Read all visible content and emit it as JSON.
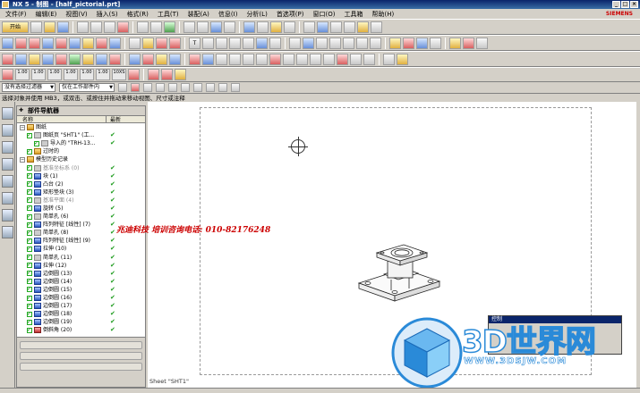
{
  "window": {
    "title": "NX 5 - 制图 - [half_pictorial.prt]",
    "brand": "SIEMENS",
    "buttons": [
      "_",
      "□",
      "×"
    ]
  },
  "menu": {
    "items": [
      "文件(F)",
      "编辑(E)",
      "视图(V)",
      "插入(S)",
      "格式(R)",
      "工具(T)",
      "装配(A)",
      "信息(I)",
      "分析(L)",
      "首选项(P)",
      "窗口(O)",
      "工具箱",
      "帮助(H)"
    ]
  },
  "toolbar_rows": [
    {
      "start_label": "开始"
    },
    {
      "labels": [
        "T"
      ]
    },
    {
      "labels": [
        "1.00",
        "1.00",
        "1.00",
        "1.00",
        "1.00",
        "1.00",
        "10XS"
      ]
    }
  ],
  "filter": {
    "selection_filter": "没有选择过滤器",
    "scope": "仅在工作部件内"
  },
  "status": {
    "prompt": "选择对象并使用 MB3，或双击、或按住并拖动来移动视图、尺寸或注释"
  },
  "navigator": {
    "title": "部件导航器",
    "columns": [
      "名称",
      "最新"
    ],
    "items": [
      {
        "label": "图纸",
        "indent": 0,
        "icon": "folder",
        "ok": false
      },
      {
        "label": "图纸页 \"SHT1\" (工...",
        "indent": 1,
        "icon": "sheet",
        "ok": true
      },
      {
        "label": "导入的 \"TRH-13...",
        "indent": 2,
        "icon": "import",
        "ok": true
      },
      {
        "label": "过时的",
        "indent": 1,
        "icon": "folder",
        "ok": false
      },
      {
        "label": "模型历史记录",
        "indent": 0,
        "icon": "folder",
        "ok": false
      },
      {
        "label": "基准坐标系 (0)",
        "indent": 1,
        "icon": "datum",
        "ok": true,
        "muted": true
      },
      {
        "label": "块 (1)",
        "indent": 1,
        "icon": "block",
        "ok": true
      },
      {
        "label": "凸台 (2)",
        "indent": 1,
        "icon": "block",
        "ok": true
      },
      {
        "label": "矩形垫块 (3)",
        "indent": 1,
        "icon": "block",
        "ok": true
      },
      {
        "label": "基准平面 (4)",
        "indent": 1,
        "icon": "datum",
        "ok": true,
        "muted": true
      },
      {
        "label": "旋转 (5)",
        "indent": 1,
        "icon": "block",
        "ok": true
      },
      {
        "label": "简单孔 (6)",
        "indent": 1,
        "icon": "hole",
        "ok": true
      },
      {
        "label": "阵列特征 [线性] (7)",
        "indent": 1,
        "icon": "pattern",
        "ok": true
      },
      {
        "label": "简单孔 (8)",
        "indent": 1,
        "icon": "hole",
        "ok": true
      },
      {
        "label": "阵列特征 [线性] (9)",
        "indent": 1,
        "icon": "pattern",
        "ok": true
      },
      {
        "label": "拉伸 (10)",
        "indent": 1,
        "icon": "block",
        "ok": true
      },
      {
        "label": "简单孔 (11)",
        "indent": 1,
        "icon": "hole",
        "ok": true
      },
      {
        "label": "拉伸 (12)",
        "indent": 1,
        "icon": "block",
        "ok": true
      },
      {
        "label": "边倒圆 (13)",
        "indent": 1,
        "icon": "blend",
        "ok": true
      },
      {
        "label": "边倒圆 (14)",
        "indent": 1,
        "icon": "blend",
        "ok": true
      },
      {
        "label": "边倒圆 (15)",
        "indent": 1,
        "icon": "blend",
        "ok": true
      },
      {
        "label": "边倒圆 (16)",
        "indent": 1,
        "icon": "blend",
        "ok": true
      },
      {
        "label": "边倒圆 (17)",
        "indent": 1,
        "icon": "blend",
        "ok": true
      },
      {
        "label": "边倒圆 (18)",
        "indent": 1,
        "icon": "blend",
        "ok": true
      },
      {
        "label": "边倒圆 (19)",
        "indent": 1,
        "icon": "blend",
        "ok": true
      },
      {
        "label": "倒斜角 (20)",
        "indent": 1,
        "icon": "chamfer",
        "ok": true
      }
    ]
  },
  "canvas": {
    "sheet_label": "Sheet \"SHT1\"",
    "overlay_text": "兆迪科技 培训咨询电话: 010-82176248"
  },
  "mini_dialog": {
    "title": "控制"
  },
  "logo": {
    "text": "3D世界网",
    "url": "WWW.3DSJW.COM"
  },
  "colors": {
    "ok_check": "#1a9a1a",
    "titlebar": "#0a246a",
    "overlay_red": "#cc0000",
    "logo_blue": "#2a8ad8"
  }
}
